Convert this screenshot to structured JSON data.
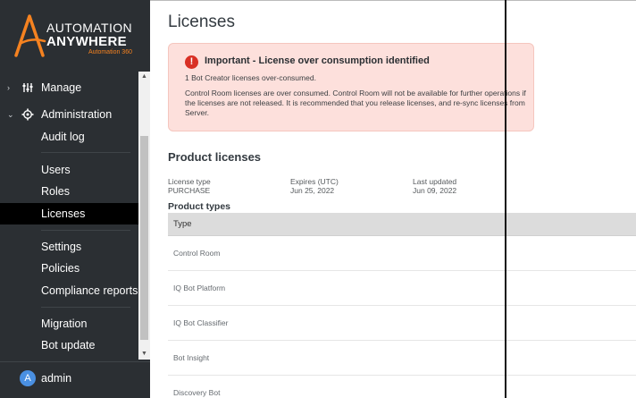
{
  "brand": {
    "line1": "AUTOMATION",
    "line2": "ANYWHERE",
    "line3": "Automation 360",
    "accent_color": "#f58220"
  },
  "sidebar": {
    "sections": [
      {
        "label": "Manage",
        "icon": "sliders-icon"
      },
      {
        "label": "Administration",
        "icon": "gear-icon"
      }
    ],
    "items": [
      {
        "label": "Audit log"
      },
      {
        "label": "Users"
      },
      {
        "label": "Roles"
      },
      {
        "label": "Licenses",
        "active": true
      },
      {
        "label": "Settings"
      },
      {
        "label": "Policies"
      },
      {
        "label": "Compliance reports"
      },
      {
        "label": "Migration"
      },
      {
        "label": "Bot update"
      }
    ],
    "user": {
      "initial": "A",
      "name": "admin"
    }
  },
  "page": {
    "title": "Licenses"
  },
  "alert": {
    "icon": "exclamation-icon",
    "title": "Important - License over consumption identified",
    "subtitle": "1 Bot Creator licenses over-consumed.",
    "body": "Control Room licenses are over consumed. Control Room will not be available for further operations if the licenses are not released. It is recommended that you release licenses, and re-sync licenses from Server.",
    "color": "#fde0dc"
  },
  "product_licenses": {
    "title": "Product licenses",
    "license_type_label": "License type",
    "license_type_value": "PURCHASE",
    "expires_label": "Expires (UTC)",
    "expires_value": "Jun 25, 2022",
    "updated_label": "Last updated",
    "updated_value": "Jun 09, 2022"
  },
  "product_types": {
    "title": "Product types",
    "column": "Type",
    "rows": [
      "Control Room",
      "IQ Bot Platform",
      "IQ Bot Classifier",
      "Bot Insight",
      "Discovery Bot"
    ]
  }
}
